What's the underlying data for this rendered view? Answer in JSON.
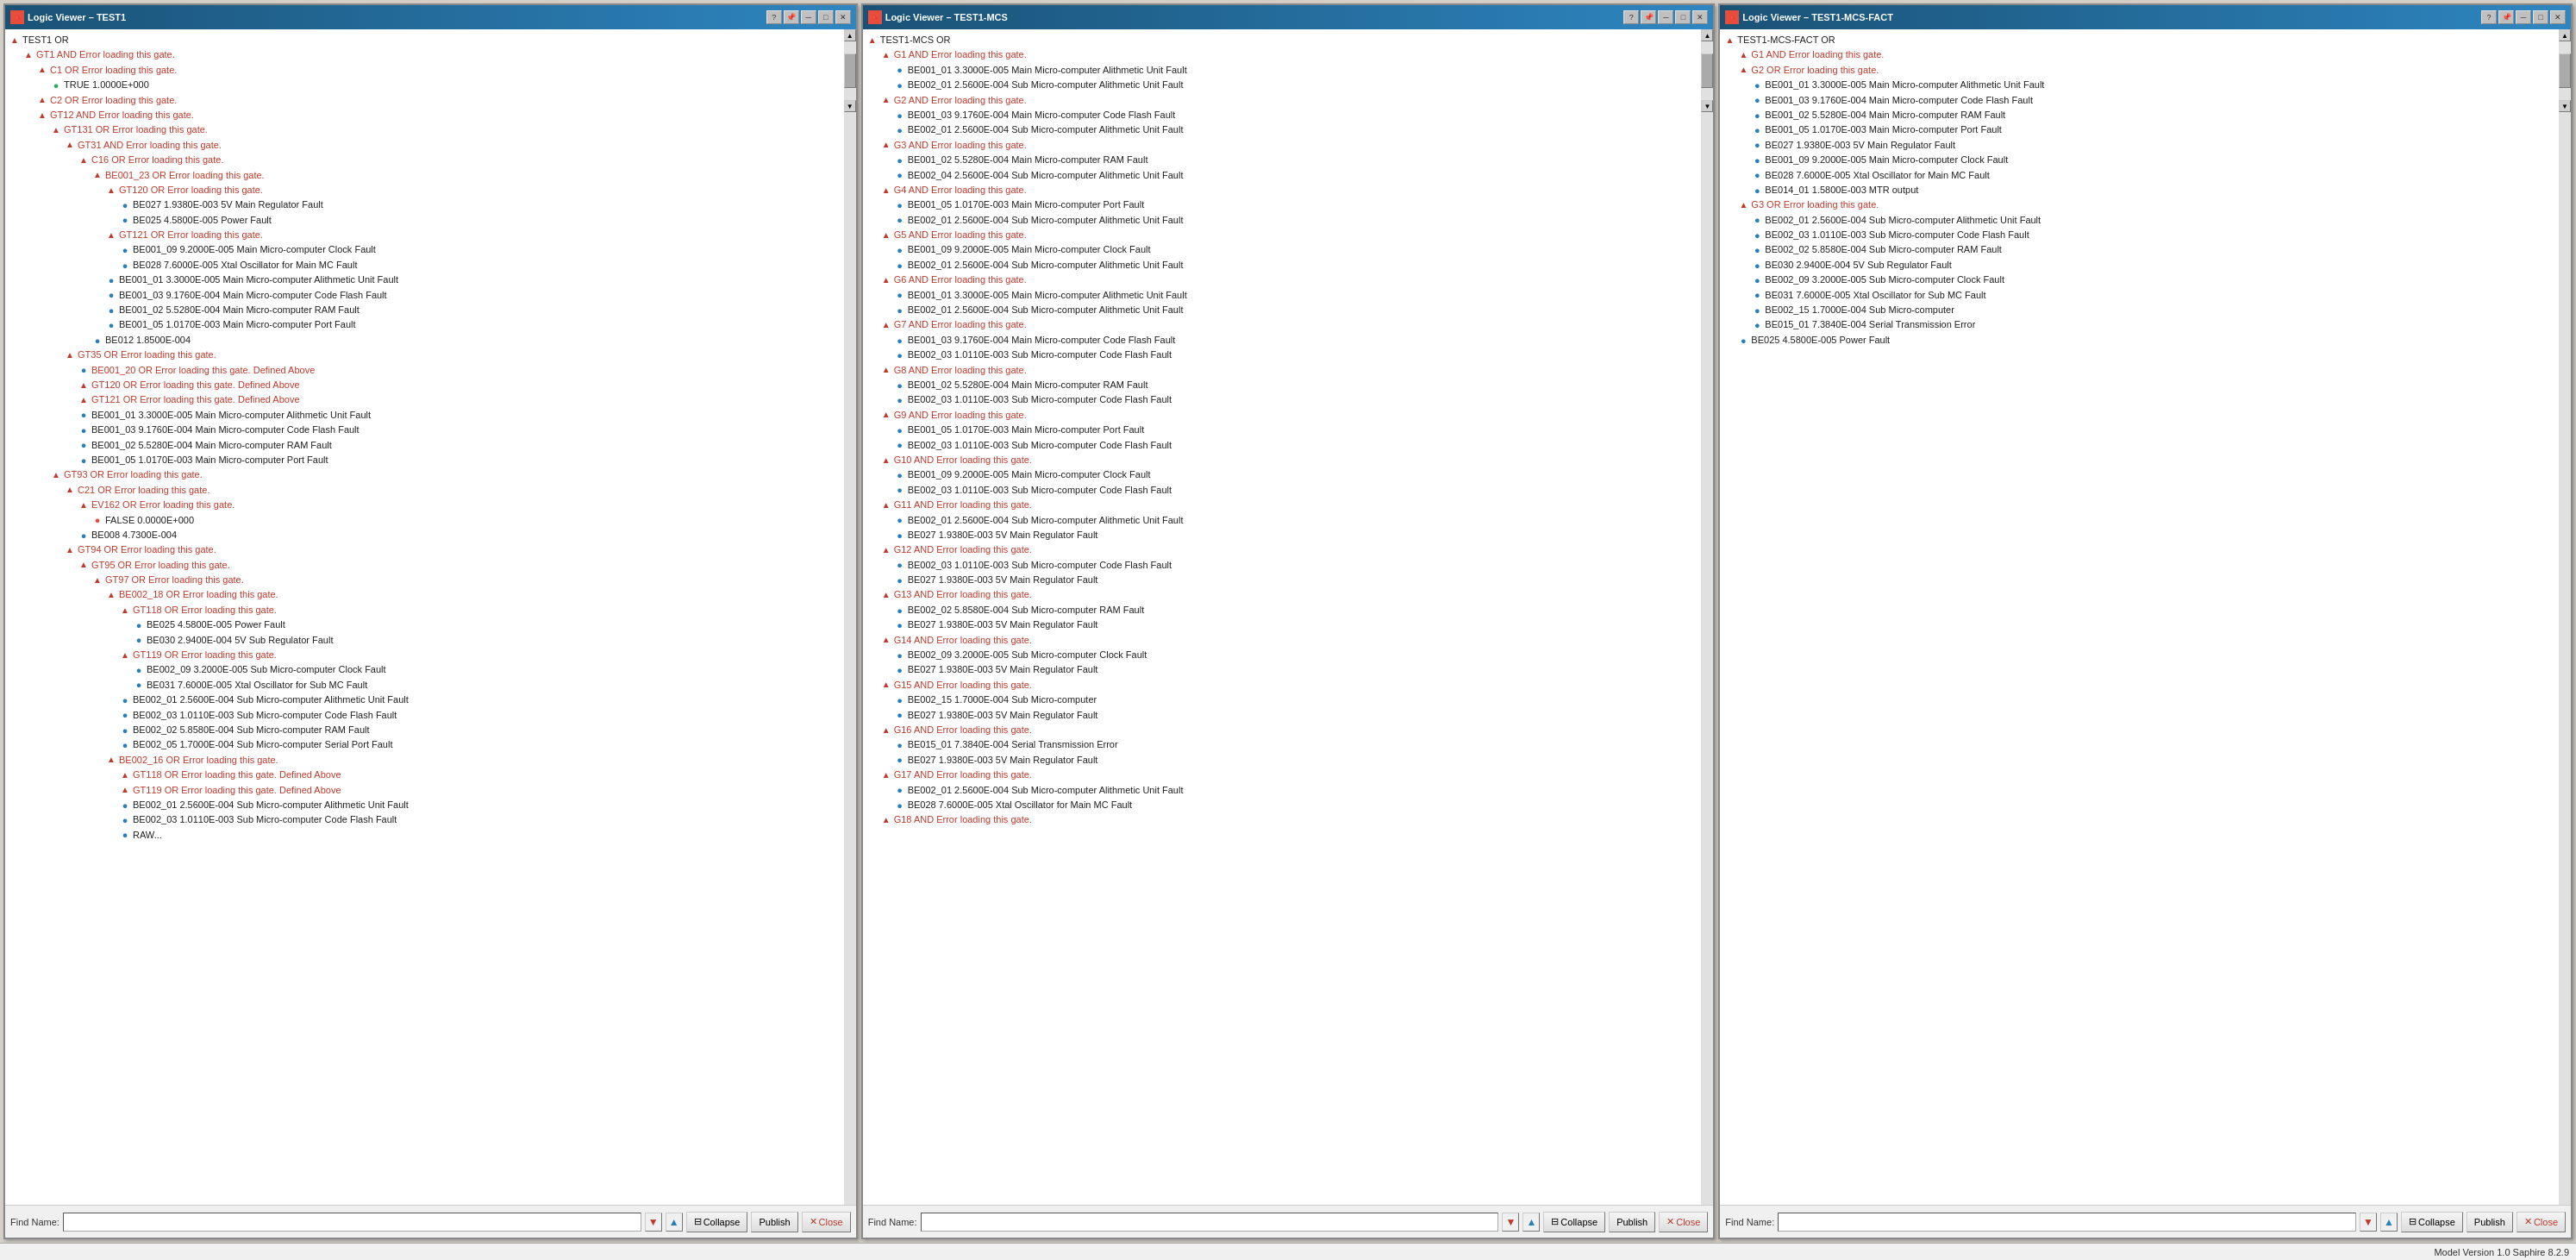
{
  "windows": [
    {
      "id": "window1",
      "title": "Logic Viewer – TEST1",
      "tree": [
        {
          "level": 0,
          "icon": "triangle-up",
          "text": "TEST1  OR"
        },
        {
          "level": 1,
          "icon": "triangle-up",
          "text": "GT1  AND   Error loading this gate."
        },
        {
          "level": 2,
          "icon": "triangle-up",
          "text": "C1  OR   Error loading this gate."
        },
        {
          "level": 3,
          "icon": "circle-green",
          "text": "TRUE   1.0000E+000"
        },
        {
          "level": 2,
          "icon": "triangle-up",
          "text": "C2  OR   Error loading this gate."
        },
        {
          "level": 2,
          "icon": "triangle-up",
          "text": "GT12  AND   Error loading this gate."
        },
        {
          "level": 3,
          "icon": "triangle-up",
          "text": "GT131  OR   Error loading this gate."
        },
        {
          "level": 4,
          "icon": "triangle-up",
          "text": "GT31  AND   Error loading this gate."
        },
        {
          "level": 5,
          "icon": "triangle-up",
          "text": "C16  OR   Error loading this gate."
        },
        {
          "level": 6,
          "icon": "triangle-up",
          "text": "BE001_23  OR   Error loading this gate."
        },
        {
          "level": 7,
          "icon": "triangle-up",
          "text": "GT120  OR   Error loading this gate."
        },
        {
          "level": 8,
          "icon": "circle-blue",
          "text": "BE027  1.9380E-003  5V Main Regulator Fault"
        },
        {
          "level": 8,
          "icon": "circle-blue",
          "text": "BE025  4.5800E-005  Power Fault"
        },
        {
          "level": 7,
          "icon": "triangle-up",
          "text": "GT121  OR   Error loading this gate."
        },
        {
          "level": 8,
          "icon": "circle-blue",
          "text": "BE001_09  9.2000E-005  Main Micro-computer Clock Fault"
        },
        {
          "level": 8,
          "icon": "circle-blue",
          "text": "BE028  7.6000E-005  Xtal Oscillator for Main MC Fault"
        },
        {
          "level": 7,
          "icon": "circle-blue",
          "text": "BE001_01  3.3000E-005  Main Micro-computer Alithmetic Unit Fault"
        },
        {
          "level": 7,
          "icon": "circle-blue",
          "text": "BE001_03  9.1760E-004  Main Micro-computer Code Flash Fault"
        },
        {
          "level": 7,
          "icon": "circle-blue",
          "text": "BE001_02  5.5280E-004  Main Micro-computer RAM Fault"
        },
        {
          "level": 7,
          "icon": "circle-blue",
          "text": "BE001_05  1.0170E-003  Main Micro-computer Port Fault"
        },
        {
          "level": 6,
          "icon": "circle-blue",
          "text": "BE012  1.8500E-004"
        },
        {
          "level": 4,
          "icon": "triangle-up",
          "text": "GT35  OR   Error loading this gate."
        },
        {
          "level": 5,
          "icon": "circle-blue",
          "text": "BE001_20  OR   Error loading this gate. Defined Above"
        },
        {
          "level": 5,
          "icon": "triangle-up",
          "text": "GT120  OR   Error loading this gate. Defined Above"
        },
        {
          "level": 5,
          "icon": "triangle-up",
          "text": "GT121  OR   Error loading this gate. Defined Above"
        },
        {
          "level": 5,
          "icon": "circle-blue",
          "text": "BE001_01  3.3000E-005  Main Micro-computer Alithmetic Unit Fault"
        },
        {
          "level": 5,
          "icon": "circle-blue",
          "text": "BE001_03  9.1760E-004  Main Micro-computer Code Flash Fault"
        },
        {
          "level": 5,
          "icon": "circle-blue",
          "text": "BE001_02  5.5280E-004  Main Micro-computer RAM Fault"
        },
        {
          "level": 5,
          "icon": "circle-blue",
          "text": "BE001_05  1.0170E-003  Main Micro-computer Port Fault"
        },
        {
          "level": 3,
          "icon": "triangle-up",
          "text": "GT93  OR   Error loading this gate."
        },
        {
          "level": 4,
          "icon": "triangle-up",
          "text": "C21  OR   Error loading this gate."
        },
        {
          "level": 5,
          "icon": "triangle-up",
          "text": "EV162  OR   Error loading this gate."
        },
        {
          "level": 6,
          "icon": "circle-red",
          "text": "FALSE  0.0000E+000"
        },
        {
          "level": 5,
          "icon": "circle-blue",
          "text": "BE008  4.7300E-004"
        },
        {
          "level": 4,
          "icon": "triangle-up",
          "text": "GT94  OR   Error loading this gate."
        },
        {
          "level": 5,
          "icon": "triangle-up",
          "text": "GT95  OR   Error loading this gate."
        },
        {
          "level": 6,
          "icon": "triangle-up",
          "text": "GT97  OR   Error loading this gate."
        },
        {
          "level": 7,
          "icon": "triangle-up",
          "text": "BE002_18  OR   Error loading this gate."
        },
        {
          "level": 8,
          "icon": "triangle-up",
          "text": "GT118  OR   Error loading this gate."
        },
        {
          "level": 9,
          "icon": "circle-blue",
          "text": "BE025  4.5800E-005  Power Fault"
        },
        {
          "level": 9,
          "icon": "circle-blue",
          "text": "BE030  2.9400E-004  5V Sub Regulator Fault"
        },
        {
          "level": 8,
          "icon": "triangle-up",
          "text": "GT119  OR   Error loading this gate."
        },
        {
          "level": 9,
          "icon": "circle-blue",
          "text": "BE002_09  3.2000E-005  Sub Micro-computer Clock Fault"
        },
        {
          "level": 9,
          "icon": "circle-blue",
          "text": "BE031  7.6000E-005  Xtal Oscillator for Sub MC Fault"
        },
        {
          "level": 8,
          "icon": "circle-blue",
          "text": "BE002_01  2.5600E-004  Sub Micro-computer Alithmetic Unit Fault"
        },
        {
          "level": 8,
          "icon": "circle-blue",
          "text": "BE002_03  1.0110E-003  Sub Micro-computer Code Flash Fault"
        },
        {
          "level": 8,
          "icon": "circle-blue",
          "text": "BE002_02  5.8580E-004  Sub Micro-computer RAM Fault"
        },
        {
          "level": 8,
          "icon": "circle-blue",
          "text": "BE002_05  1.7000E-004  Sub Micro-computer Serial Port Fault"
        },
        {
          "level": 7,
          "icon": "triangle-up",
          "text": "BE002_16  OR   Error loading this gate."
        },
        {
          "level": 8,
          "icon": "triangle-up",
          "text": "GT118  OR   Error loading this gate. Defined Above"
        },
        {
          "level": 8,
          "icon": "triangle-up",
          "text": "GT119  OR   Error loading this gate. Defined Above"
        },
        {
          "level": 8,
          "icon": "circle-blue",
          "text": "BE002_01  2.5600E-004  Sub Micro-computer Alithmetic Unit Fault"
        },
        {
          "level": 8,
          "icon": "circle-blue",
          "text": "BE002_03  1.0110E-003  Sub Micro-computer Code Flash Fault"
        },
        {
          "level": 8,
          "icon": "circle-blue",
          "text": "RAW..."
        }
      ],
      "find_label": "Find Name:",
      "find_placeholder": "",
      "buttons": [
        "Collapse",
        "Publish",
        "Close"
      ]
    },
    {
      "id": "window2",
      "title": "Logic Viewer – TEST1-MCS",
      "tree": [
        {
          "level": 0,
          "icon": "triangle-up",
          "text": "TEST1-MCS  OR"
        },
        {
          "level": 1,
          "icon": "triangle-up",
          "text": "G1  AND   Error loading this gate."
        },
        {
          "level": 2,
          "icon": "circle-blue",
          "text": "BE001_01  3.3000E-005  Main Micro-computer Alithmetic Unit Fault"
        },
        {
          "level": 2,
          "icon": "circle-blue",
          "text": "BE002_01  2.5600E-004  Sub Micro-computer Alithmetic Unit Fault"
        },
        {
          "level": 1,
          "icon": "triangle-up",
          "text": "G2  AND   Error loading this gate."
        },
        {
          "level": 2,
          "icon": "circle-blue",
          "text": "BE001_03  9.1760E-004  Main Micro-computer Code Flash Fault"
        },
        {
          "level": 2,
          "icon": "circle-blue",
          "text": "BE002_01  2.5600E-004  Sub Micro-computer Alithmetic Unit Fault"
        },
        {
          "level": 1,
          "icon": "triangle-up",
          "text": "G3  AND   Error loading this gate."
        },
        {
          "level": 2,
          "icon": "circle-blue",
          "text": "BE001_02  5.5280E-004  Main Micro-computer RAM Fault"
        },
        {
          "level": 2,
          "icon": "circle-blue",
          "text": "BE002_04  2.5600E-004  Sub Micro-computer Alithmetic Unit Fault"
        },
        {
          "level": 1,
          "icon": "triangle-up",
          "text": "G4  AND   Error loading this gate."
        },
        {
          "level": 2,
          "icon": "circle-blue",
          "text": "BE001_05  1.0170E-003  Main Micro-computer Port Fault"
        },
        {
          "level": 2,
          "icon": "circle-blue",
          "text": "BE002_01  2.5600E-004  Sub Micro-computer Alithmetic Unit Fault"
        },
        {
          "level": 1,
          "icon": "triangle-up",
          "text": "G5  AND   Error loading this gate."
        },
        {
          "level": 2,
          "icon": "circle-blue",
          "text": "BE001_09  9.2000E-005  Main Micro-computer Clock Fault"
        },
        {
          "level": 2,
          "icon": "circle-blue",
          "text": "BE002_01  2.5600E-004  Sub Micro-computer Alithmetic Unit Fault"
        },
        {
          "level": 1,
          "icon": "triangle-up",
          "text": "G6  AND   Error loading this gate."
        },
        {
          "level": 2,
          "icon": "circle-blue",
          "text": "BE001_01  3.3000E-005  Main Micro-computer Alithmetic Unit Fault"
        },
        {
          "level": 2,
          "icon": "circle-blue",
          "text": "BE002_01  2.5600E-004  Sub Micro-computer Alithmetic Unit Fault"
        },
        {
          "level": 1,
          "icon": "triangle-up",
          "text": "G7  AND   Error loading this gate."
        },
        {
          "level": 2,
          "icon": "circle-blue",
          "text": "BE001_03  9.1760E-004  Main Micro-computer Code Flash Fault"
        },
        {
          "level": 2,
          "icon": "circle-blue",
          "text": "BE002_03  1.0110E-003  Sub Micro-computer Code Flash Fault"
        },
        {
          "level": 1,
          "icon": "triangle-up",
          "text": "G8  AND   Error loading this gate."
        },
        {
          "level": 2,
          "icon": "circle-blue",
          "text": "BE001_02  5.5280E-004  Main Micro-computer RAM Fault"
        },
        {
          "level": 2,
          "icon": "circle-blue",
          "text": "BE002_03  1.0110E-003  Sub Micro-computer Code Flash Fault"
        },
        {
          "level": 1,
          "icon": "triangle-up",
          "text": "G9  AND   Error loading this gate."
        },
        {
          "level": 2,
          "icon": "circle-blue",
          "text": "BE001_05  1.0170E-003  Main Micro-computer Port Fault"
        },
        {
          "level": 2,
          "icon": "circle-blue",
          "text": "BE002_03  1.0110E-003  Sub Micro-computer Code Flash Fault"
        },
        {
          "level": 1,
          "icon": "triangle-up",
          "text": "G10  AND   Error loading this gate."
        },
        {
          "level": 2,
          "icon": "circle-blue",
          "text": "BE001_09  9.2000E-005  Main Micro-computer Clock Fault"
        },
        {
          "level": 2,
          "icon": "circle-blue",
          "text": "BE002_03  1.0110E-003  Sub Micro-computer Code Flash Fault"
        },
        {
          "level": 1,
          "icon": "triangle-up",
          "text": "G11  AND   Error loading this gate."
        },
        {
          "level": 2,
          "icon": "circle-blue",
          "text": "BE002_01  2.5600E-004  Sub Micro-computer Alithmetic Unit Fault"
        },
        {
          "level": 2,
          "icon": "circle-blue",
          "text": "BE027  1.9380E-003  5V Main Regulator Fault"
        },
        {
          "level": 1,
          "icon": "triangle-up",
          "text": "G12  AND   Error loading this gate."
        },
        {
          "level": 2,
          "icon": "circle-blue",
          "text": "BE002_03  1.0110E-003  Sub Micro-computer Code Flash Fault"
        },
        {
          "level": 2,
          "icon": "circle-blue",
          "text": "BE027  1.9380E-003  5V Main Regulator Fault"
        },
        {
          "level": 1,
          "icon": "triangle-up",
          "text": "G13  AND   Error loading this gate."
        },
        {
          "level": 2,
          "icon": "circle-blue",
          "text": "BE002_02  5.8580E-004  Sub Micro-computer RAM Fault"
        },
        {
          "level": 2,
          "icon": "circle-blue",
          "text": "BE027  1.9380E-003  5V Main Regulator Fault"
        },
        {
          "level": 1,
          "icon": "triangle-up",
          "text": "G14  AND   Error loading this gate."
        },
        {
          "level": 2,
          "icon": "circle-blue",
          "text": "BE002_09  3.2000E-005  Sub Micro-computer Clock Fault"
        },
        {
          "level": 2,
          "icon": "circle-blue",
          "text": "BE027  1.9380E-003  5V Main Regulator Fault"
        },
        {
          "level": 1,
          "icon": "triangle-up",
          "text": "G15  AND   Error loading this gate."
        },
        {
          "level": 2,
          "icon": "circle-blue",
          "text": "BE002_15  1.7000E-004  Sub Micro-computer"
        },
        {
          "level": 2,
          "icon": "circle-blue",
          "text": "BE027  1.9380E-003  5V Main Regulator Fault"
        },
        {
          "level": 1,
          "icon": "triangle-up",
          "text": "G16  AND   Error loading this gate."
        },
        {
          "level": 2,
          "icon": "circle-blue",
          "text": "BE015_01  7.3840E-004  Serial Transmission Error"
        },
        {
          "level": 2,
          "icon": "circle-blue",
          "text": "BE027  1.9380E-003  5V Main Regulator Fault"
        },
        {
          "level": 1,
          "icon": "triangle-up",
          "text": "G17  AND   Error loading this gate."
        },
        {
          "level": 2,
          "icon": "circle-blue",
          "text": "BE002_01  2.5600E-004  Sub Micro-computer Alithmetic Unit Fault"
        },
        {
          "level": 2,
          "icon": "circle-blue",
          "text": "BE028  7.6000E-005  Xtal Oscillator for Main MC Fault"
        },
        {
          "level": 1,
          "icon": "triangle-up",
          "text": "G18  AND   Error loading this gate."
        }
      ],
      "find_label": "Find Name:",
      "find_placeholder": "",
      "buttons": [
        "Collapse",
        "Publish",
        "Close"
      ]
    },
    {
      "id": "window3",
      "title": "Logic Viewer – TEST1-MCS-FACT",
      "tree": [
        {
          "level": 0,
          "icon": "triangle-up",
          "text": "TEST1-MCS-FACT  OR"
        },
        {
          "level": 1,
          "icon": "triangle-up",
          "text": "G1  AND   Error loading this gate."
        },
        {
          "level": 1,
          "icon": "triangle-up",
          "text": "G2  OR   Error loading this gate."
        },
        {
          "level": 2,
          "icon": "circle-blue",
          "text": "BE001_01  3.3000E-005  Main Micro-computer Alithmetic Unit Fault"
        },
        {
          "level": 2,
          "icon": "circle-blue",
          "text": "BE001_03  9.1760E-004  Main Micro-computer Code Flash Fault"
        },
        {
          "level": 2,
          "icon": "circle-blue",
          "text": "BE001_02  5.5280E-004  Main Micro-computer RAM Fault"
        },
        {
          "level": 2,
          "icon": "circle-blue",
          "text": "BE001_05  1.0170E-003  Main Micro-computer Port Fault"
        },
        {
          "level": 2,
          "icon": "circle-blue",
          "text": "BE027  1.9380E-003  5V Main Regulator Fault"
        },
        {
          "level": 2,
          "icon": "circle-blue",
          "text": "BE001_09  9.2000E-005  Main Micro-computer Clock Fault"
        },
        {
          "level": 2,
          "icon": "circle-blue",
          "text": "BE028  7.6000E-005  Xtal Oscillator for Main MC Fault"
        },
        {
          "level": 2,
          "icon": "circle-blue",
          "text": "BE014_01  1.5800E-003  MTR output"
        },
        {
          "level": 1,
          "icon": "triangle-up",
          "text": "G3  OR   Error loading this gate."
        },
        {
          "level": 2,
          "icon": "circle-blue",
          "text": "BE002_01  2.5600E-004  Sub Micro-computer Alithmetic Unit Fault"
        },
        {
          "level": 2,
          "icon": "circle-blue",
          "text": "BE002_03  1.0110E-003  Sub Micro-computer Code Flash Fault"
        },
        {
          "level": 2,
          "icon": "circle-blue",
          "text": "BE002_02  5.8580E-004  Sub Micro-computer RAM Fault"
        },
        {
          "level": 2,
          "icon": "circle-blue",
          "text": "BE030  2.9400E-004  5V Sub Regulator Fault"
        },
        {
          "level": 2,
          "icon": "circle-blue",
          "text": "BE002_09  3.2000E-005  Sub Micro-computer Clock Fault"
        },
        {
          "level": 2,
          "icon": "circle-blue",
          "text": "BE031  7.6000E-005  Xtal Oscillator for Sub MC Fault"
        },
        {
          "level": 2,
          "icon": "circle-blue",
          "text": "BE002_15  1.7000E-004  Sub Micro-computer"
        },
        {
          "level": 2,
          "icon": "circle-blue",
          "text": "BE015_01  7.3840E-004  Serial Transmission Error"
        },
        {
          "level": 1,
          "icon": "circle-blue",
          "text": "BE025  4.5800E-005  Power Fault"
        }
      ],
      "find_label": "Find Name:",
      "find_placeholder": "",
      "buttons": [
        "Collapse",
        "Publish",
        "Close"
      ]
    }
  ],
  "status_bar": {
    "text": "Model Version 1.0   Saphire 8.2.9"
  },
  "icons": {
    "triangle_up": "▲",
    "triangle_down": "▼",
    "circle": "●",
    "arrow_up": "▲",
    "arrow_down": "▼",
    "close_x": "✕",
    "help": "?",
    "pin": "📌",
    "collapse_icon": "⊟",
    "expand_icon": "⊞"
  }
}
